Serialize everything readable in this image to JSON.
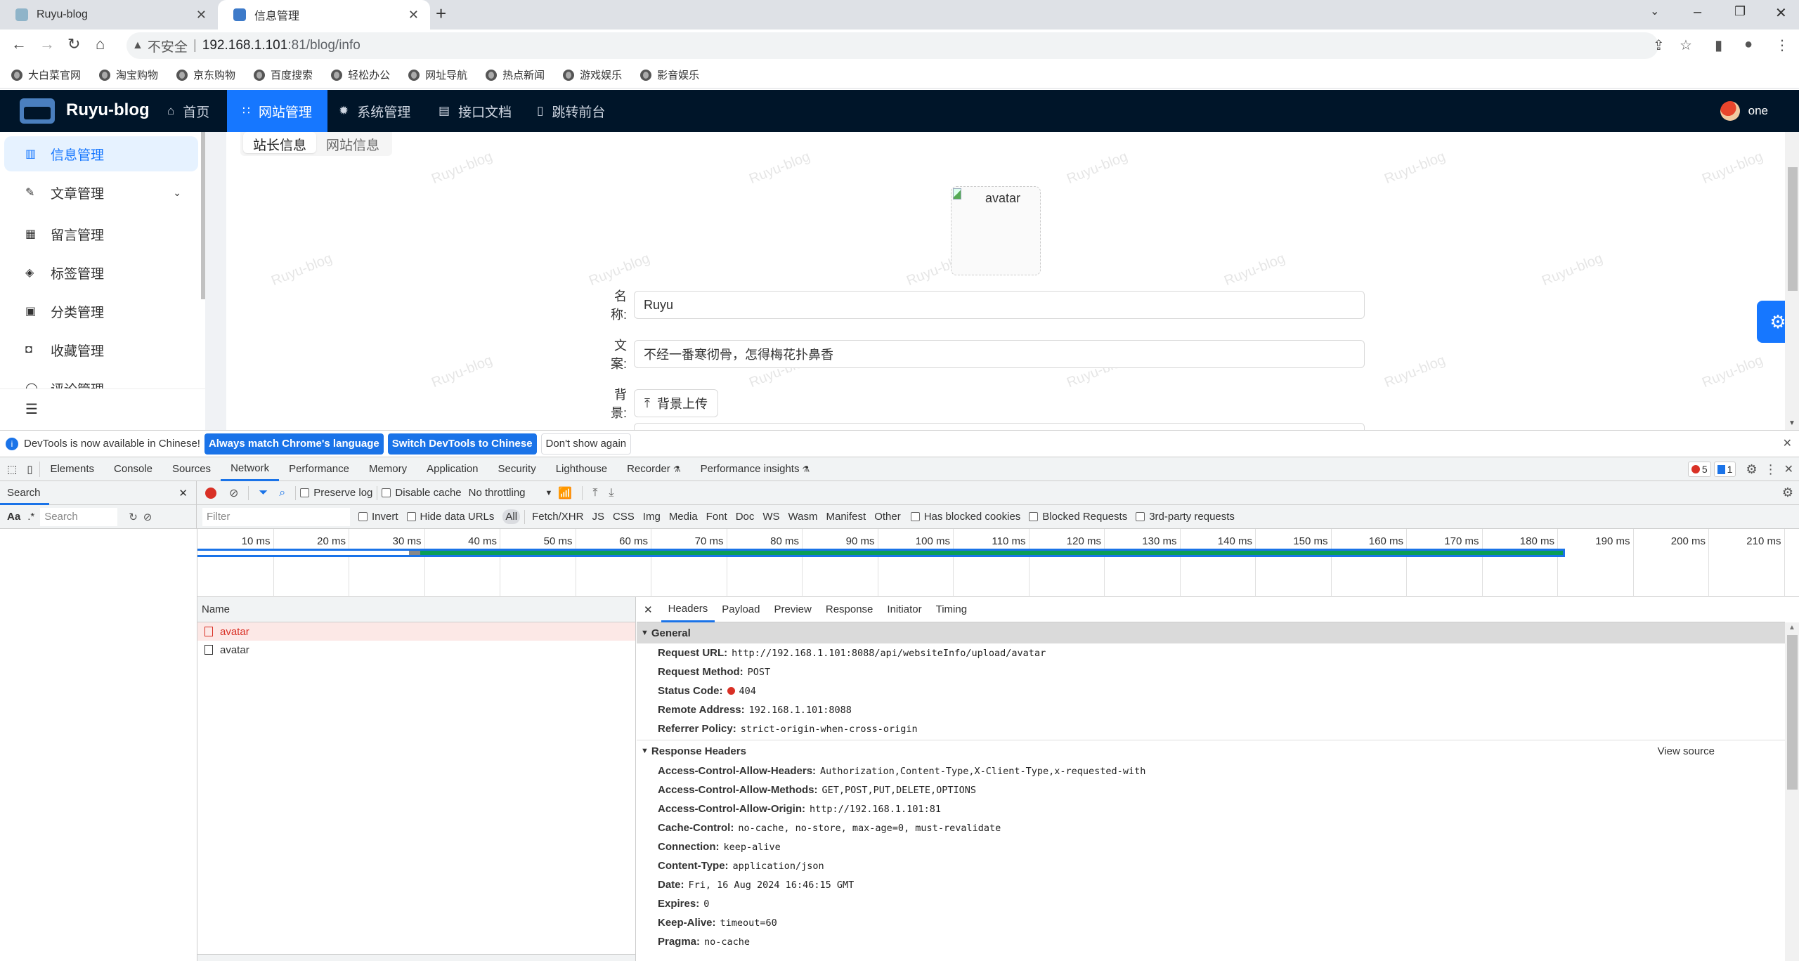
{
  "browser": {
    "tabs": [
      {
        "title": "Ruyu-blog",
        "active": false
      },
      {
        "title": "信息管理",
        "active": true
      }
    ],
    "new_tab": "+",
    "address": {
      "security_label": "不安全",
      "host": "192.168.1.101",
      "path": ":81/blog/info"
    },
    "bookmarks": [
      "大白菜官网",
      "淘宝购物",
      "京东购物",
      "百度搜索",
      "轻松办公",
      "网址导航",
      "热点新闻",
      "游戏娱乐",
      "影音娱乐"
    ]
  },
  "app": {
    "brand": "Ruyu-blog",
    "nav": [
      {
        "label": "首页",
        "icon": "home-icon",
        "active": false
      },
      {
        "label": "网站管理",
        "icon": "grid-icon",
        "active": true
      },
      {
        "label": "系统管理",
        "icon": "gear-icon",
        "active": false
      },
      {
        "label": "接口文档",
        "icon": "document-icon",
        "active": false
      },
      {
        "label": "跳转前台",
        "icon": "mobile-icon",
        "active": false
      }
    ],
    "user": "one",
    "sidebar": [
      {
        "label": "信息管理",
        "icon": "book-icon",
        "active": true
      },
      {
        "label": "文章管理",
        "icon": "edit-icon",
        "active": false,
        "expandable": true
      },
      {
        "label": "留言管理",
        "icon": "calendar-icon",
        "active": false
      },
      {
        "label": "标签管理",
        "icon": "tag-icon",
        "active": false
      },
      {
        "label": "分类管理",
        "icon": "category-icon",
        "active": false
      },
      {
        "label": "收藏管理",
        "icon": "inbox-icon",
        "active": false
      },
      {
        "label": "评论管理",
        "icon": "comment-icon",
        "active": false
      }
    ],
    "segments": [
      {
        "label": "站长信息",
        "active": true
      },
      {
        "label": "网站信息",
        "active": false
      }
    ],
    "watermark": "Ruyu-blog",
    "avatar_alt": "avatar",
    "form": {
      "name_label": "名称:",
      "name_value": "Ruyu",
      "motto_label": "文案:",
      "motto_value": "不经一番寒彻骨，怎得梅花扑鼻香",
      "bg_label": "背景:",
      "bg_button": "背景上传"
    }
  },
  "devtools": {
    "infobar": {
      "message": "DevTools is now available in Chinese!",
      "btn_match": "Always match Chrome's language",
      "btn_switch": "Switch DevTools to Chinese",
      "btn_dismiss": "Don't show again"
    },
    "tabs": [
      "Elements",
      "Console",
      "Sources",
      "Network",
      "Performance",
      "Memory",
      "Application",
      "Security",
      "Lighthouse",
      "Recorder",
      "Performance insights"
    ],
    "active_tab": "Network",
    "error_count": "5",
    "message_count": "1",
    "search_panel_title": "Search",
    "search_placeholder": "Search",
    "search_case": "Aa",
    "search_regex": ".*",
    "toolbar": {
      "preserve_log": "Preserve log",
      "disable_cache": "Disable cache",
      "throttling": "No throttling"
    },
    "filter": {
      "placeholder": "Filter",
      "invert": "Invert",
      "hide_data_urls": "Hide data URLs",
      "types": [
        "All",
        "Fetch/XHR",
        "JS",
        "CSS",
        "Img",
        "Media",
        "Font",
        "Doc",
        "WS",
        "Wasm",
        "Manifest",
        "Other"
      ],
      "active_type": "All",
      "has_blocked_cookies": "Has blocked cookies",
      "blocked_requests": "Blocked Requests",
      "third_party": "3rd-party requests"
    },
    "timeline": {
      "ticks": [
        "10 ms",
        "20 ms",
        "30 ms",
        "40 ms",
        "50 ms",
        "60 ms",
        "70 ms",
        "80 ms",
        "90 ms",
        "100 ms",
        "110 ms",
        "120 ms",
        "130 ms",
        "140 ms",
        "150 ms",
        "160 ms",
        "170 ms",
        "180 ms",
        "190 ms",
        "200 ms",
        "210 ms"
      ],
      "request_start_ms": 0,
      "waiting_end_ms": 28,
      "receive_start_ms": 29.5,
      "request_end_ms": 181
    },
    "requests": {
      "column": "Name",
      "rows": [
        {
          "name": "avatar",
          "error": true
        },
        {
          "name": "avatar",
          "error": false
        }
      ]
    },
    "detail_tabs": [
      "Headers",
      "Payload",
      "Preview",
      "Response",
      "Initiator",
      "Timing"
    ],
    "active_detail_tab": "Headers",
    "general": {
      "title": "General",
      "rows": [
        {
          "key": "Request URL:",
          "value": "http://192.168.1.101:8088/api/websiteInfo/upload/avatar"
        },
        {
          "key": "Request Method:",
          "value": "POST"
        },
        {
          "key": "Status Code:",
          "value": "404",
          "status_dot": true
        },
        {
          "key": "Remote Address:",
          "value": "192.168.1.101:8088"
        },
        {
          "key": "Referrer Policy:",
          "value": "strict-origin-when-cross-origin"
        }
      ]
    },
    "response_headers": {
      "title": "Response Headers",
      "view_source": "View source",
      "rows": [
        {
          "key": "Access-Control-Allow-Headers:",
          "value": "Authorization,Content-Type,X-Client-Type,x-requested-with"
        },
        {
          "key": "Access-Control-Allow-Methods:",
          "value": "GET,POST,PUT,DELETE,OPTIONS"
        },
        {
          "key": "Access-Control-Allow-Origin:",
          "value": "http://192.168.1.101:81"
        },
        {
          "key": "Cache-Control:",
          "value": "no-cache, no-store, max-age=0, must-revalidate"
        },
        {
          "key": "Connection:",
          "value": "keep-alive"
        },
        {
          "key": "Content-Type:",
          "value": "application/json"
        },
        {
          "key": "Date:",
          "value": "Fri, 16 Aug 2024 16:46:15 GMT"
        },
        {
          "key": "Expires:",
          "value": "0"
        },
        {
          "key": "Keep-Alive:",
          "value": "timeout=60"
        },
        {
          "key": "Pragma:",
          "value": "no-cache"
        }
      ]
    }
  }
}
